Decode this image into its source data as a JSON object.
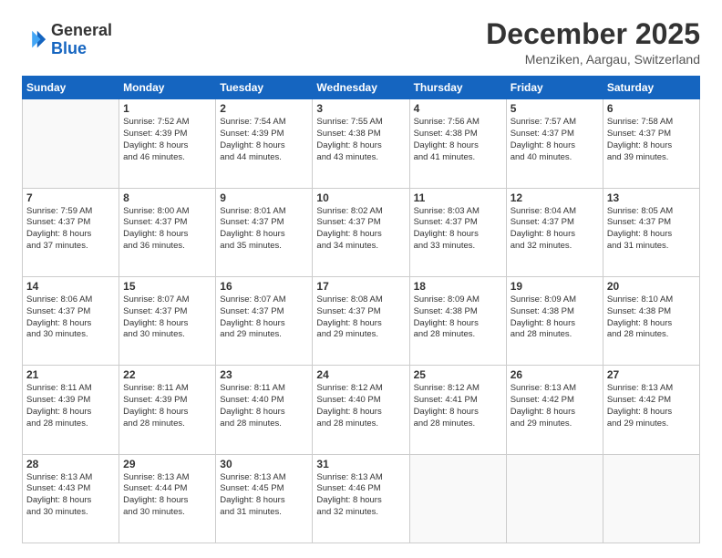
{
  "header": {
    "logo_line1": "General",
    "logo_line2": "Blue",
    "month": "December 2025",
    "location": "Menziken, Aargau, Switzerland"
  },
  "days_of_week": [
    "Sunday",
    "Monday",
    "Tuesday",
    "Wednesday",
    "Thursday",
    "Friday",
    "Saturday"
  ],
  "weeks": [
    [
      {
        "day": "",
        "info": ""
      },
      {
        "day": "1",
        "info": "Sunrise: 7:52 AM\nSunset: 4:39 PM\nDaylight: 8 hours\nand 46 minutes."
      },
      {
        "day": "2",
        "info": "Sunrise: 7:54 AM\nSunset: 4:39 PM\nDaylight: 8 hours\nand 44 minutes."
      },
      {
        "day": "3",
        "info": "Sunrise: 7:55 AM\nSunset: 4:38 PM\nDaylight: 8 hours\nand 43 minutes."
      },
      {
        "day": "4",
        "info": "Sunrise: 7:56 AM\nSunset: 4:38 PM\nDaylight: 8 hours\nand 41 minutes."
      },
      {
        "day": "5",
        "info": "Sunrise: 7:57 AM\nSunset: 4:37 PM\nDaylight: 8 hours\nand 40 minutes."
      },
      {
        "day": "6",
        "info": "Sunrise: 7:58 AM\nSunset: 4:37 PM\nDaylight: 8 hours\nand 39 minutes."
      }
    ],
    [
      {
        "day": "7",
        "info": "Sunrise: 7:59 AM\nSunset: 4:37 PM\nDaylight: 8 hours\nand 37 minutes."
      },
      {
        "day": "8",
        "info": "Sunrise: 8:00 AM\nSunset: 4:37 PM\nDaylight: 8 hours\nand 36 minutes."
      },
      {
        "day": "9",
        "info": "Sunrise: 8:01 AM\nSunset: 4:37 PM\nDaylight: 8 hours\nand 35 minutes."
      },
      {
        "day": "10",
        "info": "Sunrise: 8:02 AM\nSunset: 4:37 PM\nDaylight: 8 hours\nand 34 minutes."
      },
      {
        "day": "11",
        "info": "Sunrise: 8:03 AM\nSunset: 4:37 PM\nDaylight: 8 hours\nand 33 minutes."
      },
      {
        "day": "12",
        "info": "Sunrise: 8:04 AM\nSunset: 4:37 PM\nDaylight: 8 hours\nand 32 minutes."
      },
      {
        "day": "13",
        "info": "Sunrise: 8:05 AM\nSunset: 4:37 PM\nDaylight: 8 hours\nand 31 minutes."
      }
    ],
    [
      {
        "day": "14",
        "info": "Sunrise: 8:06 AM\nSunset: 4:37 PM\nDaylight: 8 hours\nand 30 minutes."
      },
      {
        "day": "15",
        "info": "Sunrise: 8:07 AM\nSunset: 4:37 PM\nDaylight: 8 hours\nand 30 minutes."
      },
      {
        "day": "16",
        "info": "Sunrise: 8:07 AM\nSunset: 4:37 PM\nDaylight: 8 hours\nand 29 minutes."
      },
      {
        "day": "17",
        "info": "Sunrise: 8:08 AM\nSunset: 4:37 PM\nDaylight: 8 hours\nand 29 minutes."
      },
      {
        "day": "18",
        "info": "Sunrise: 8:09 AM\nSunset: 4:38 PM\nDaylight: 8 hours\nand 28 minutes."
      },
      {
        "day": "19",
        "info": "Sunrise: 8:09 AM\nSunset: 4:38 PM\nDaylight: 8 hours\nand 28 minutes."
      },
      {
        "day": "20",
        "info": "Sunrise: 8:10 AM\nSunset: 4:38 PM\nDaylight: 8 hours\nand 28 minutes."
      }
    ],
    [
      {
        "day": "21",
        "info": "Sunrise: 8:11 AM\nSunset: 4:39 PM\nDaylight: 8 hours\nand 28 minutes."
      },
      {
        "day": "22",
        "info": "Sunrise: 8:11 AM\nSunset: 4:39 PM\nDaylight: 8 hours\nand 28 minutes."
      },
      {
        "day": "23",
        "info": "Sunrise: 8:11 AM\nSunset: 4:40 PM\nDaylight: 8 hours\nand 28 minutes."
      },
      {
        "day": "24",
        "info": "Sunrise: 8:12 AM\nSunset: 4:40 PM\nDaylight: 8 hours\nand 28 minutes."
      },
      {
        "day": "25",
        "info": "Sunrise: 8:12 AM\nSunset: 4:41 PM\nDaylight: 8 hours\nand 28 minutes."
      },
      {
        "day": "26",
        "info": "Sunrise: 8:13 AM\nSunset: 4:42 PM\nDaylight: 8 hours\nand 29 minutes."
      },
      {
        "day": "27",
        "info": "Sunrise: 8:13 AM\nSunset: 4:42 PM\nDaylight: 8 hours\nand 29 minutes."
      }
    ],
    [
      {
        "day": "28",
        "info": "Sunrise: 8:13 AM\nSunset: 4:43 PM\nDaylight: 8 hours\nand 30 minutes."
      },
      {
        "day": "29",
        "info": "Sunrise: 8:13 AM\nSunset: 4:44 PM\nDaylight: 8 hours\nand 30 minutes."
      },
      {
        "day": "30",
        "info": "Sunrise: 8:13 AM\nSunset: 4:45 PM\nDaylight: 8 hours\nand 31 minutes."
      },
      {
        "day": "31",
        "info": "Sunrise: 8:13 AM\nSunset: 4:46 PM\nDaylight: 8 hours\nand 32 minutes."
      },
      {
        "day": "",
        "info": ""
      },
      {
        "day": "",
        "info": ""
      },
      {
        "day": "",
        "info": ""
      }
    ]
  ]
}
